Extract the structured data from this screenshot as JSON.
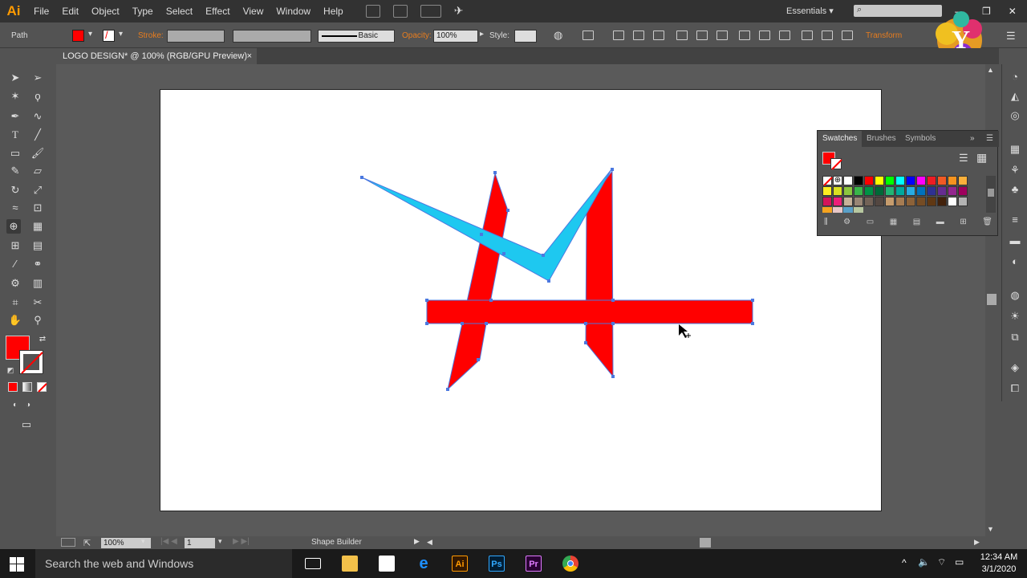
{
  "app": {
    "logo": "Ai"
  },
  "menu": [
    "File",
    "Edit",
    "Object",
    "Type",
    "Select",
    "Effect",
    "View",
    "Window",
    "Help"
  ],
  "menu_icons": [
    "bridge-icon",
    "stock-icon",
    "arrange-documents-icon",
    "gpu-performance-icon"
  ],
  "workspace": "Essentials",
  "search_placeholder": "",
  "control": {
    "selection_label": "Path",
    "fill_color": "#ff0000",
    "stroke_label": "Stroke:",
    "brush_label": "Basic",
    "opacity_label": "Opacity:",
    "opacity_value": "100%",
    "style_label": "Style:",
    "transform_label": "Transform"
  },
  "document": {
    "tab_title": "LOGO DESIGN* @ 100% (RGB/GPU Preview)",
    "close": "×"
  },
  "tools": [
    "selection-tool-icon",
    "direct-selection-tool-icon",
    "magic-wand-tool-icon",
    "lasso-tool-icon",
    "pen-tool-icon",
    "curvature-tool-icon",
    "type-tool-icon",
    "line-segment-tool-icon",
    "rectangle-tool-icon",
    "paintbrush-tool-icon",
    "pencil-tool-icon",
    "eraser-tool-icon",
    "rotate-tool-icon",
    "scale-tool-icon",
    "width-tool-icon",
    "free-transform-tool-icon",
    "shape-builder-tool-icon",
    "perspective-grid-tool-icon",
    "mesh-tool-icon",
    "gradient-tool-icon",
    "eyedropper-tool-icon",
    "blend-tool-icon",
    "symbol-sprayer-tool-icon",
    "column-graph-tool-icon",
    "artboard-tool-icon",
    "slice-tool-icon",
    "hand-tool-icon",
    "zoom-tool-icon"
  ],
  "swatches_panel": {
    "tabs": [
      "Swatches",
      "Brushes",
      "Symbols"
    ],
    "row1": [
      "#ffffff",
      "#000000",
      "#ff0000",
      "#ffff00",
      "#00ff00",
      "#00ffff",
      "#0000ff",
      "#ff00ff",
      "#ed1c24",
      "#f15a24",
      "#f7931e",
      "#fbb03b"
    ],
    "row2": [
      "#fcee21",
      "#d9e021",
      "#8cc63f",
      "#39b54a",
      "#009245",
      "#006837",
      "#22b573",
      "#00a99d",
      "#29abe2",
      "#0071bc",
      "#2e3192",
      "#662d91",
      "#93278f",
      "#9e005d"
    ],
    "row3": [
      "#d4145a",
      "#ed1e79",
      "#c7b299",
      "#998675",
      "#736357",
      "#534741",
      "#c69c6d",
      "#a67c52",
      "#8c6239",
      "#754c24",
      "#603813",
      "#42210b",
      "#ffffff",
      "#b3b3b3"
    ]
  },
  "status": {
    "zoom": "100%",
    "artboard": "1",
    "tool_name": "Shape Builder"
  },
  "taskbar": {
    "search_text": "Search the web and Windows",
    "apps": [
      "task-view-icon",
      "file-explorer-icon",
      "store-icon",
      "edge-icon",
      "illustrator-icon",
      "photoshop-icon",
      "premiere-icon",
      "chrome-icon"
    ],
    "app_labels": {
      "illustrator": "Ai",
      "photoshop": "Ps",
      "premiere": "Pr"
    },
    "time": "12:34 AM",
    "date": "3/1/2020"
  },
  "colors": {
    "red": "#ff0000",
    "cyan": "#1ec8f0",
    "anchor": "#4a78e0"
  }
}
